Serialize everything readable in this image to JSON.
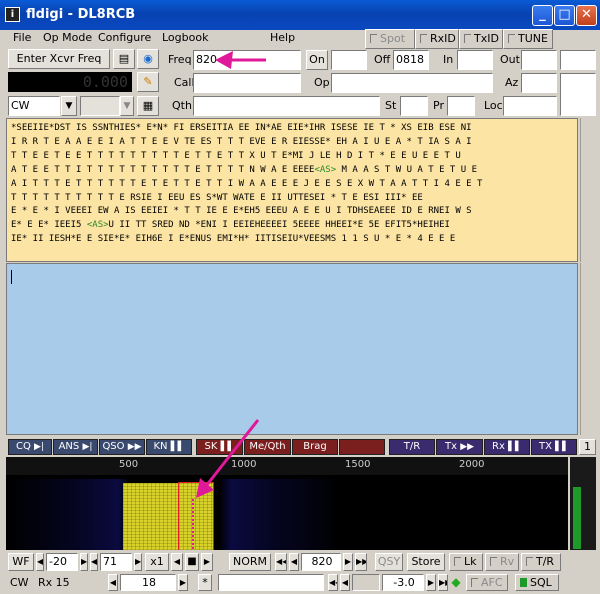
{
  "window": {
    "title": "fldigi - DL8RCB",
    "min": "_",
    "max": "□",
    "close": "✕",
    "app_icon": "i"
  },
  "menu": {
    "items": [
      "File",
      "Op Mode",
      "Configure",
      "Logbook",
      "Help"
    ]
  },
  "toggles": {
    "spot": "Spot",
    "rxid": "RxID",
    "txid": "TxID",
    "tune": "TUNE"
  },
  "rig": {
    "enter_freq": "Enter Xcvr Freq",
    "freq_display": "0.000",
    "mode": "CW"
  },
  "log": {
    "freq_label": "Freq",
    "freq_value": "820",
    "on_label": "On",
    "on_value": "",
    "off_label": "Off",
    "off_value": "0818",
    "in_label": "In",
    "in_value": "",
    "out_label": "Out",
    "out_value": "",
    "call_label": "Call",
    "op_label": "Op",
    "az_label": "Az",
    "qth_label": "Qth",
    "st_label": "St",
    "pr_label": "Pr",
    "loc_label": "Loc"
  },
  "rx_lines": [
    "*SEEIIE*DST IS SSNTHIES* E*N* FI ERSEITIA EE IN*AE EIE*IHR ISESE IE T * XS EIB ESE NI",
    "I R R T E A A E E I A T T E E V TE ES T T T EVE E R EIESSE* EH A I U E A * T IA S A I",
    "T T E E T E E T T T T T T T T T E T T E T T X U T E*MI J LE H D I T * E E U E E T U",
    "A T E E T T I T T T T T T T T T T E T T T T N W A E EEEE<AS> M A A S T W U A T E T U E",
    "A I T T T E T T T T T T E T E T T E T T I W A A E E E J E E S E X W T A A T T I 4 E E T",
    "T T T T T T T T T T E RSIE I EEU ES S*WT WATE E II UTTESEI * T E ESI III* EE",
    "E * E * I VEEEI EW A IS EEIEI * T T IE E E*EH5 EEEU A E E U I TDHSEAEEE ID E RNEI W S",
    "E* E E* IEEI5 <AS>U II TT SRED ND *ENI I EEIEHEEEEI 5EEEE HHEEI*E 5E EFIT5*HEIHEI",
    "IE* II IESH*E E SIE*E* EIH6E I E*ENUS EMI*H* IITISEIU*VEESMS 1 1 S U * E * 4 E E E"
  ],
  "macros": {
    "cq": "CQ",
    "ans": "ANS",
    "qso": "QSO",
    "kn": "KN",
    "sk": "SK",
    "meqth": "Me/Qth",
    "brag": "Brag",
    "blank": "",
    "tr": "T/R",
    "tx": "Tx",
    "rx": "Rx",
    "txstop": "TX",
    "page": "1"
  },
  "waterfall": {
    "ticks": [
      "500",
      "1000",
      "1500",
      "2000"
    ]
  },
  "wf_controls": {
    "wf": "WF",
    "ref": "-20",
    "range": "71",
    "zoom": "x1",
    "speed": "NORM",
    "freq": "820",
    "qsy": "QSY",
    "store": "Store",
    "lk": "Lk",
    "rv": "Rv",
    "tr": "T/R"
  },
  "status": {
    "mode": "CW",
    "rx": "Rx 15",
    "wpm": "18",
    "star": "*",
    "level": "-3.0",
    "afc": "AFC",
    "sql": "SQL"
  },
  "colors": {
    "titlebar": "#0842b0",
    "rx_bg": "#fbe4a4",
    "tx_bg": "#a7cbe9",
    "annotation": "#e0189a",
    "signal": "#e8e02a"
  }
}
